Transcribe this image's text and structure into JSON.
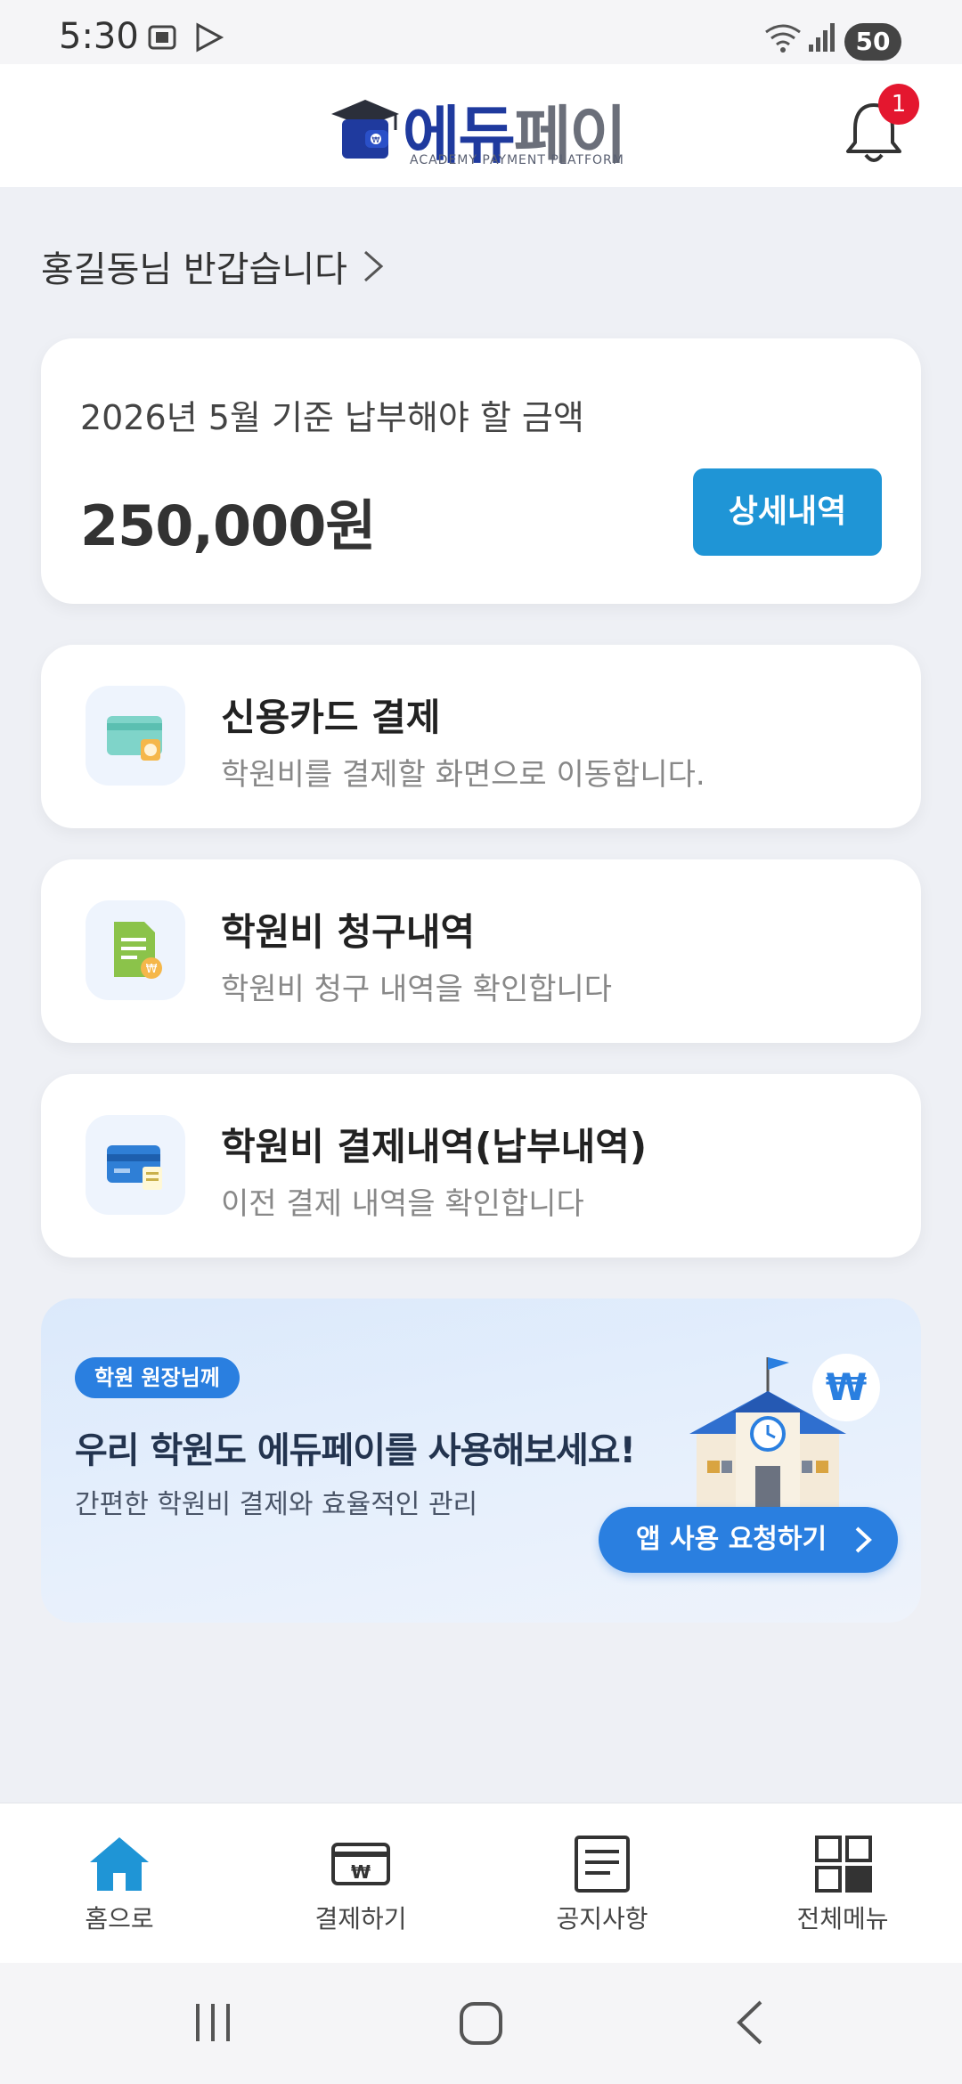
{
  "status_bar": {
    "time": "5:30",
    "battery": "50",
    "icons": [
      "screenshot-icon",
      "play-icon",
      "wifi-icon",
      "signal-icon"
    ]
  },
  "header": {
    "logo_main_1": "에듀",
    "logo_main_2": "페이",
    "logo_sub": "ACADEMY PAYMENT PLATFORM",
    "notification_count": "1",
    "brand_blue": "#1f3a9e",
    "brand_gray": "#6b6f7a"
  },
  "greeting": {
    "text": "홍길동님 반갑습니다"
  },
  "summary": {
    "label": "2026년 5월 기준 납부해야 할 금액",
    "amount": "250,000원",
    "detail_button": "상세내역"
  },
  "menu": [
    {
      "title": "신용카드 결제",
      "desc": "학원비를 결제할 화면으로 이동합니다.",
      "icon": "credit-card-icon"
    },
    {
      "title": "학원비 청구내역",
      "desc": "학원비 청구 내역을 확인합니다",
      "icon": "invoice-document-icon"
    },
    {
      "title": "학원비 결제내역(납부내역)",
      "desc": "이전 결제 내역을 확인합니다",
      "icon": "payment-history-card-icon"
    }
  ],
  "promo": {
    "badge": "학원 원장님께",
    "title": "우리 학원도 에듀페이를 사용해보세요!",
    "subtitle": "간편한 학원비 결제와 효율적인 관리",
    "button": "앱 사용 요청하기",
    "currency_symbol": "₩"
  },
  "bottom_nav": [
    {
      "label": "홈으로",
      "icon": "home-icon",
      "active": true
    },
    {
      "label": "결제하기",
      "icon": "payment-icon",
      "active": false
    },
    {
      "label": "공지사항",
      "icon": "notice-icon",
      "active": false
    },
    {
      "label": "전체메뉴",
      "icon": "grid-menu-icon",
      "active": false
    }
  ],
  "colors": {
    "accent": "#1f95d6",
    "promo_blue": "#2a7fe0",
    "badge_red": "#e4172f",
    "background": "#eef0f5"
  }
}
